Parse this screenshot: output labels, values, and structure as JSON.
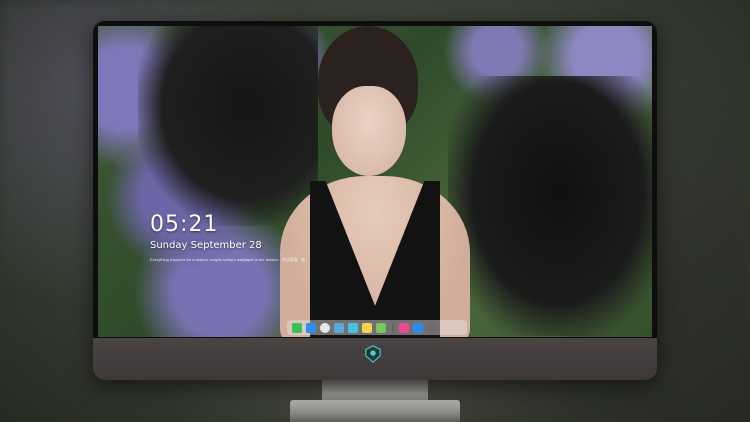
{
  "desktop": {
    "clock": "05:21",
    "date": "Sunday September 28",
    "quote": "Everything happens for a reason, maybe today's wallpaper is the reason · 今日寄语 · 每日一句",
    "wallpaper": "woman-with-black-wings-hydrangea-photo"
  },
  "dock": {
    "items": [
      {
        "name": "finder-icon",
        "color": "#3fbf5a"
      },
      {
        "name": "messages-icon",
        "color": "#2f8ef0"
      },
      {
        "name": "safari-icon",
        "color": "#e8e8e8"
      },
      {
        "name": "launchpad-icon",
        "color": "#5ca9d8"
      },
      {
        "name": "video-icon",
        "color": "#48c3e0"
      },
      {
        "name": "notes-icon",
        "color": "#f6d34a"
      },
      {
        "name": "photos-icon",
        "color": "#7fc25a"
      },
      {
        "name": "music-icon",
        "color": "#f0478f"
      },
      {
        "name": "appstore-icon",
        "color": "#2d8cf0"
      },
      {
        "name": "camera-icon",
        "color": "#6e6e6e"
      }
    ]
  },
  "colors": {
    "bezel": "#0d0d0e",
    "chin": "#4a4444",
    "accent_logo": "#4fd0c8"
  }
}
